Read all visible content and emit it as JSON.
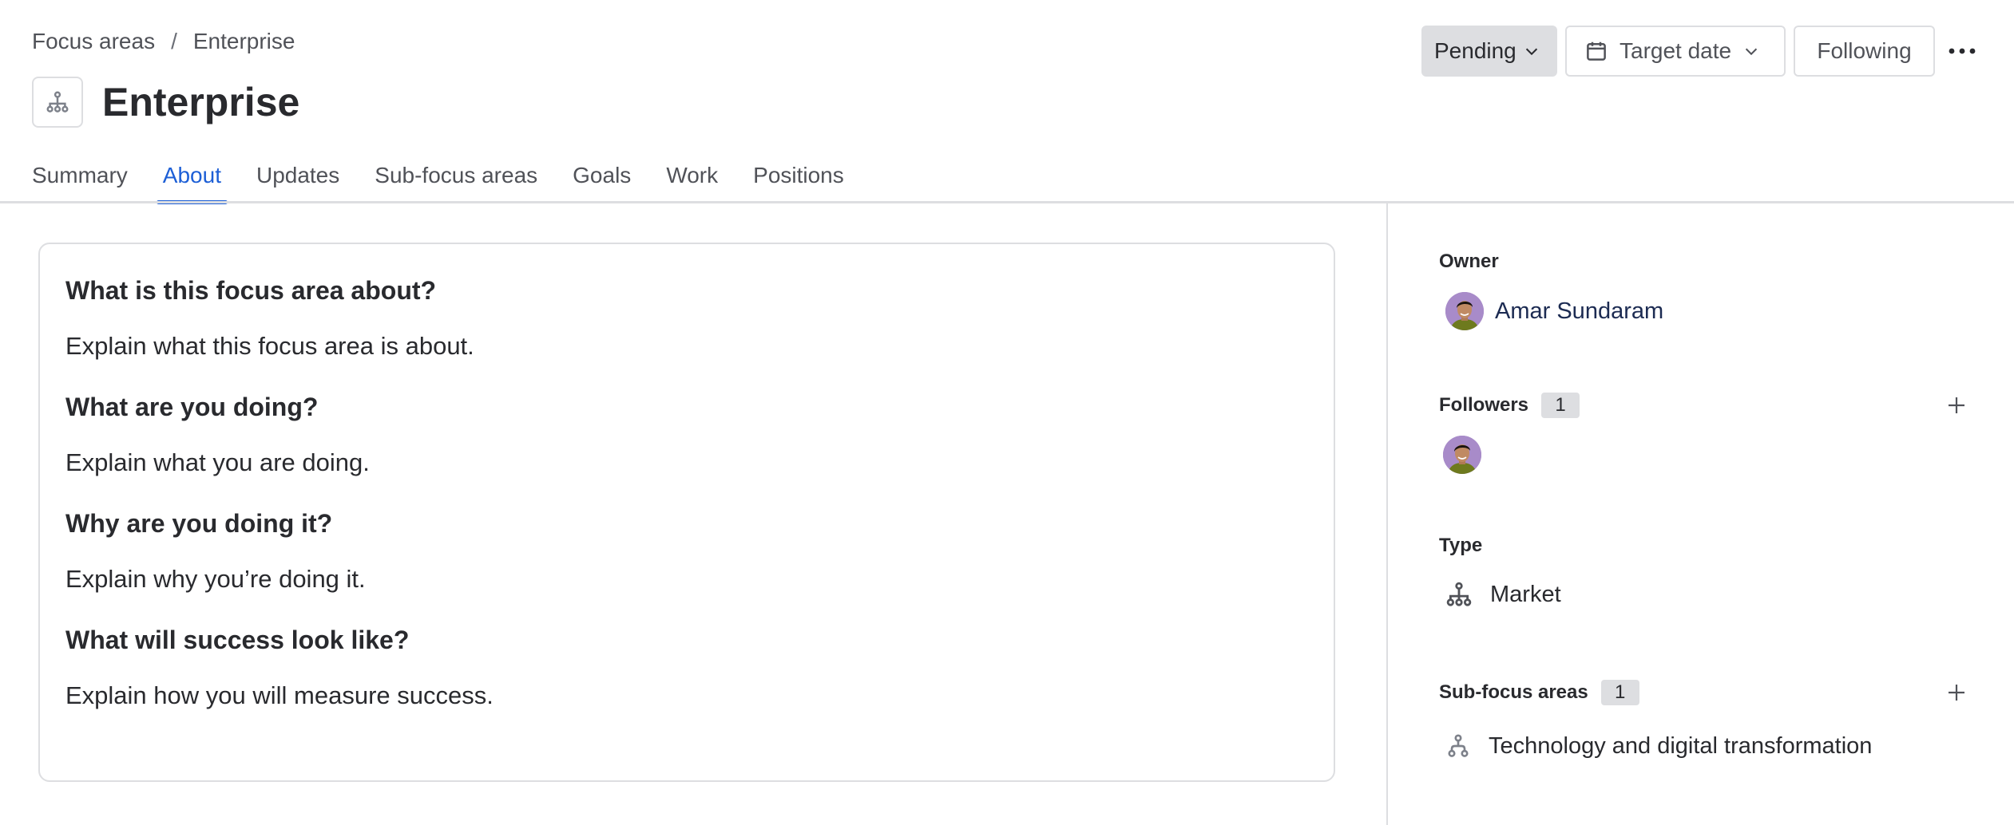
{
  "breadcrumb": {
    "items": [
      "Focus areas",
      "Enterprise"
    ],
    "separator": "/"
  },
  "header": {
    "title": "Enterprise",
    "icon": "hierarchy-icon"
  },
  "actions": {
    "status_label": "Pending",
    "target_date_label": "Target date",
    "following_label": "Following",
    "more_label": "•••"
  },
  "tabs": [
    {
      "label": "Summary",
      "active": false
    },
    {
      "label": "About",
      "active": true
    },
    {
      "label": "Updates",
      "active": false
    },
    {
      "label": "Sub-focus areas",
      "active": false
    },
    {
      "label": "Goals",
      "active": false
    },
    {
      "label": "Work",
      "active": false
    },
    {
      "label": "Positions",
      "active": false
    }
  ],
  "about": {
    "sections": [
      {
        "heading": "What is this focus area about?",
        "body": "Explain what this focus area is about."
      },
      {
        "heading": "What are you doing?",
        "body": "Explain what you are doing."
      },
      {
        "heading": "Why are you doing it?",
        "body": "Explain why you’re doing it."
      },
      {
        "heading": "What will success look like?",
        "body": "Explain how you will measure success."
      }
    ]
  },
  "sidebar": {
    "owner": {
      "label": "Owner",
      "name": "Amar Sundaram"
    },
    "followers": {
      "label": "Followers",
      "count": "1"
    },
    "type": {
      "label": "Type",
      "value": "Market"
    },
    "sub_focus_areas": {
      "label": "Sub-focus areas",
      "count": "1",
      "items": [
        "Technology and digital transformation"
      ]
    }
  },
  "colors": {
    "accent": "#1d5fd6",
    "border": "#dddee1",
    "status_bg": "#dddee1",
    "text": "#292a2e"
  }
}
